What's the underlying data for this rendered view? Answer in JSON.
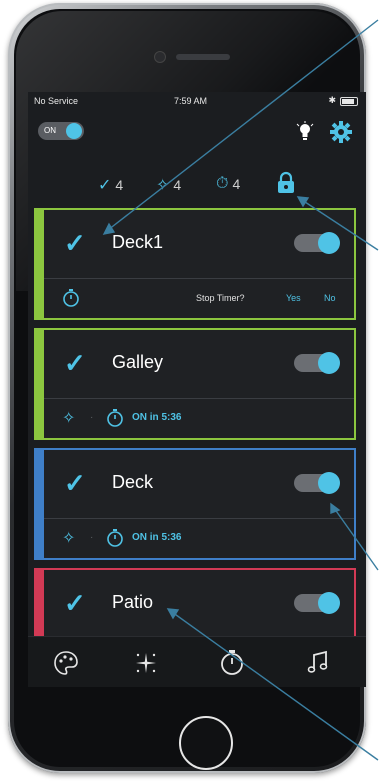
{
  "status_bar": {
    "carrier": "No Service",
    "time": "7:59 AM"
  },
  "header": {
    "power_label": "ON"
  },
  "stats": {
    "checked_count": "4",
    "effects_count": "4",
    "timers_count": "4"
  },
  "zones": [
    {
      "name": "Deck1",
      "color": "#8cc63f",
      "on": true,
      "stop_timer_label": "Stop Timer?",
      "yes_label": "Yes",
      "no_label": "No"
    },
    {
      "name": "Galley",
      "color": "#8cc63f",
      "on": true,
      "timer_text": "ON in 5:36"
    },
    {
      "name": "Deck",
      "color": "#3f7fc8",
      "on": true,
      "timer_text": "ON in 5:36"
    },
    {
      "name": "Patio",
      "color": "#d23a55",
      "on": true
    }
  ],
  "tabs": [
    {
      "icon": "palette-icon"
    },
    {
      "icon": "sparkle-icon"
    },
    {
      "icon": "timer-icon"
    },
    {
      "icon": "music-icon"
    }
  ],
  "colors": {
    "accent": "#4fc3e6",
    "screen_bg": "#1b1d20",
    "callout_line": "#3a7ea0"
  }
}
